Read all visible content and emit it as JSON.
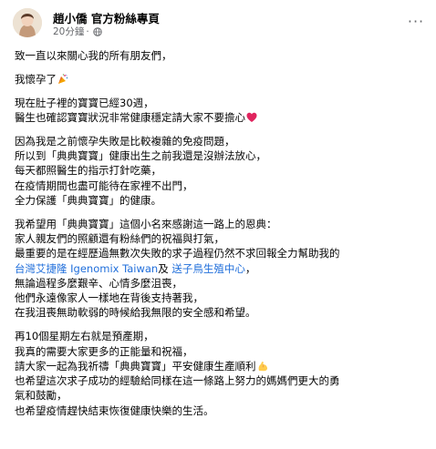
{
  "post": {
    "author": "趙小僑 官方粉絲專頁",
    "time": "20分鐘",
    "separator": "·",
    "more_label": "···",
    "colors": {
      "link": "#216fdb",
      "meta": "#65676b",
      "text": "#050505"
    },
    "icons": {
      "privacy": "globe-icon",
      "party": "party-popper-icon",
      "heart": "red-heart-icon",
      "strength": "flexed-biceps-icon"
    },
    "paragraphs": [
      {
        "lines": [
          "致一直以來關心我的所有朋友們，"
        ]
      },
      {
        "lines": [
          "我懷孕了"
        ]
      },
      {
        "lines": [
          "現在肚子裡的寶寶已經30週，",
          "醫生也確認寶寶狀況非常健康穩定請大家不要擔心"
        ]
      },
      {
        "lines": [
          "因為我是之前懷孕失敗是比較複雜的免疫問題，",
          "所以到「典典寶寶」健康出生之前我還是沒辦法放心，",
          "每天都照醫生的指示打針吃藥，",
          "在疫情期間也盡可能待在家裡不出門，",
          "全力保護「典典寶寶」的健康。"
        ]
      },
      {
        "lines": [
          "我希望用「典典寶寶」這個小名來感謝這一路上的恩典：",
          "家人親友們的照顧還有粉絲們的祝福與打氣，",
          "最重要的是在經歷過無數次失敗的求子過程仍然不求回報全力幫助我的"
        ],
        "link_line": {
          "link1": "台灣艾捷隆 Igenomix Taiwan",
          "mid": "及 ",
          "link2": "送子鳥生殖中心",
          "end": "，"
        },
        "tail_lines": [
          "無論過程多麼艱辛、心情多麼沮喪，",
          "他們永遠像家人一樣地在背後支持著我，",
          "在我沮喪無助軟弱的時候給我無限的安全感和希望。"
        ]
      },
      {
        "lines": [
          "再10個星期左右就是預產期，",
          "我真的需要大家更多的正能量和祝福，",
          "請大家一起為我祈禱「典典寶寶」平安健康生產順利",
          "也希望這次求子成功的經驗給同樣在這一條路上努力的媽媽們更大的勇",
          "氣和鼓勵，",
          "也希望疫情趕快結束恢復健康快樂的生活。"
        ]
      }
    ]
  }
}
